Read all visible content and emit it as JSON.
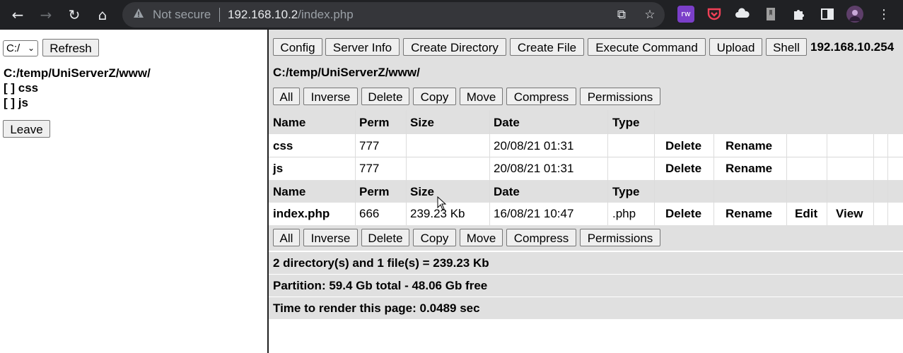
{
  "browser": {
    "security_label": "Not secure",
    "url_host": "192.168.10.2",
    "url_path": "/index.php",
    "icons": [
      "back-arrow-icon",
      "forward-arrow-icon",
      "reload-icon",
      "home-icon",
      "warning-icon",
      "share-icon",
      "star-icon",
      "extension-rw-icon",
      "pocket-icon",
      "cloud-icon",
      "bookmark-icon",
      "puzzle-icon",
      "sidepanel-icon",
      "profile-avatar-icon",
      "kebab-menu-icon"
    ],
    "ext_rw_label": "rw"
  },
  "left": {
    "drive_value": "C:/",
    "refresh_label": "Refresh",
    "current_path": "C:/temp/UniServerZ/www/",
    "tree": [
      {
        "label": "[ ] css"
      },
      {
        "label": "[ ] js"
      }
    ],
    "leave_label": "Leave"
  },
  "toolbar": {
    "buttons": [
      "Config",
      "Server Info",
      "Create Directory",
      "Create File",
      "Execute Command",
      "Upload",
      "Shell"
    ],
    "server_ip": "192.168.10.254"
  },
  "path": "C:/temp/UniServerZ/www/",
  "actions_bar": [
    "All",
    "Inverse",
    "Delete",
    "Copy",
    "Move",
    "Compress",
    "Permissions"
  ],
  "table": {
    "headers": [
      "Name",
      "Perm",
      "Size",
      "Date",
      "Type"
    ],
    "directories": [
      {
        "name": "css",
        "perm": "777",
        "size": "",
        "date": "20/08/21 01:31",
        "type": "",
        "actions": [
          "Delete",
          "Rename"
        ]
      },
      {
        "name": "js",
        "perm": "777",
        "size": "",
        "date": "20/08/21 01:31",
        "type": "",
        "actions": [
          "Delete",
          "Rename"
        ]
      }
    ],
    "files": [
      {
        "name": "index.php",
        "perm": "666",
        "size": "239.23 Kb",
        "date": "16/08/21 10:47",
        "type": ".php",
        "actions": [
          "Delete",
          "Rename",
          "Edit",
          "View"
        ]
      }
    ]
  },
  "summary": {
    "counts": "2 directory(s) and 1 file(s) = 239.23 Kb",
    "partition": "Partition: 59.4 Gb total - 48.06 Gb free",
    "render_time": "Time to render this page: 0.0489 sec"
  }
}
